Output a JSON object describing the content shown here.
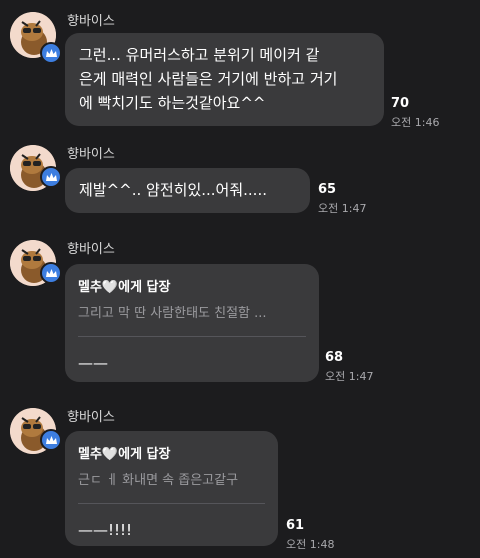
{
  "messages": [
    {
      "sender": "향바이스",
      "lines": [
        "그런... 유머러스하고 분위기 메이커 같",
        "은게 매력인 사람들은 거기에 반하고 거기",
        "에 빡치기도 하는것같아요^^"
      ],
      "count": "70",
      "time": "오전 1:46"
    },
    {
      "sender": "향바이스",
      "lines": [
        "제발^^.. 얌전히있...어줘....."
      ],
      "count": "65",
      "time": "오전 1:47"
    },
    {
      "sender": "향바이스",
      "reply_to": "멜추",
      "reply_suffix": "에게 답장",
      "quote": "그리고 막 딴 사람한태도 친절함 ...",
      "body": "——",
      "count": "68",
      "time": "오전 1:47"
    },
    {
      "sender": "향바이스",
      "reply_to": "멜추",
      "reply_suffix": "에게 답장",
      "quote": "근ㄷ ㅔ 화내면 속 좁은고같구",
      "body": "——!!!!",
      "count": "61",
      "time": "오전 1:48"
    }
  ],
  "colors": {
    "background": "#1c1c1e",
    "bubble": "#3a3a3c",
    "badge": "#3d7ee0"
  },
  "icons": {
    "avatar": "kakao-ryan-avatar",
    "badge": "crown-badge-icon",
    "heart": "white-heart-icon"
  }
}
